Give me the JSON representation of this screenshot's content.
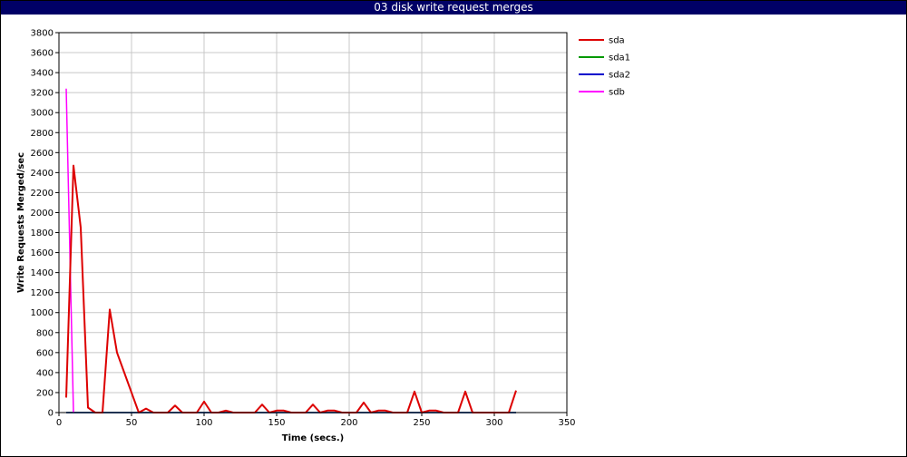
{
  "chart_data": {
    "type": "line",
    "title": "03 disk write request merges",
    "xlabel": "Time (secs.)",
    "ylabel": "Write Requests Merged/sec",
    "xlim": [
      0,
      350
    ],
    "ylim": [
      0,
      3800
    ],
    "xticks": [
      0,
      50,
      100,
      150,
      200,
      250,
      300,
      350
    ],
    "yticks": [
      0,
      200,
      400,
      600,
      800,
      1000,
      1200,
      1400,
      1600,
      1800,
      2000,
      2200,
      2400,
      2600,
      2800,
      3000,
      3200,
      3400,
      3600,
      3800
    ],
    "grid": true,
    "legend_position": "right",
    "series": [
      {
        "name": "sda",
        "color": "#dd0000",
        "x": [
          5,
          10,
          15,
          20,
          25,
          30,
          35,
          40,
          45,
          50,
          55,
          60,
          65,
          70,
          75,
          80,
          85,
          90,
          95,
          100,
          105,
          110,
          115,
          120,
          125,
          130,
          135,
          140,
          145,
          150,
          155,
          160,
          165,
          170,
          175,
          180,
          185,
          190,
          195,
          200,
          205,
          210,
          215,
          220,
          225,
          230,
          235,
          240,
          245,
          250,
          255,
          260,
          265,
          270,
          275,
          280,
          285,
          290,
          295,
          300,
          305,
          310,
          315
        ],
        "values": [
          150,
          2470,
          1850,
          50,
          0,
          0,
          1030,
          600,
          400,
          200,
          0,
          40,
          0,
          0,
          0,
          70,
          0,
          0,
          0,
          110,
          0,
          0,
          20,
          0,
          0,
          0,
          0,
          80,
          0,
          20,
          20,
          0,
          0,
          0,
          80,
          0,
          20,
          20,
          0,
          0,
          0,
          100,
          0,
          20,
          20,
          0,
          0,
          0,
          210,
          0,
          20,
          20,
          0,
          0,
          0,
          210,
          0,
          0,
          0,
          0,
          0,
          0,
          220
        ]
      },
      {
        "name": "sda1",
        "color": "#009900",
        "x": [
          5,
          315
        ],
        "values": [
          0,
          0
        ]
      },
      {
        "name": "sda2",
        "color": "#0000cc",
        "x": [
          5,
          315
        ],
        "values": [
          0,
          0
        ]
      },
      {
        "name": "sdb",
        "color": "#ff00ff",
        "x": [
          5,
          10
        ],
        "values": [
          3240,
          0
        ]
      }
    ]
  }
}
